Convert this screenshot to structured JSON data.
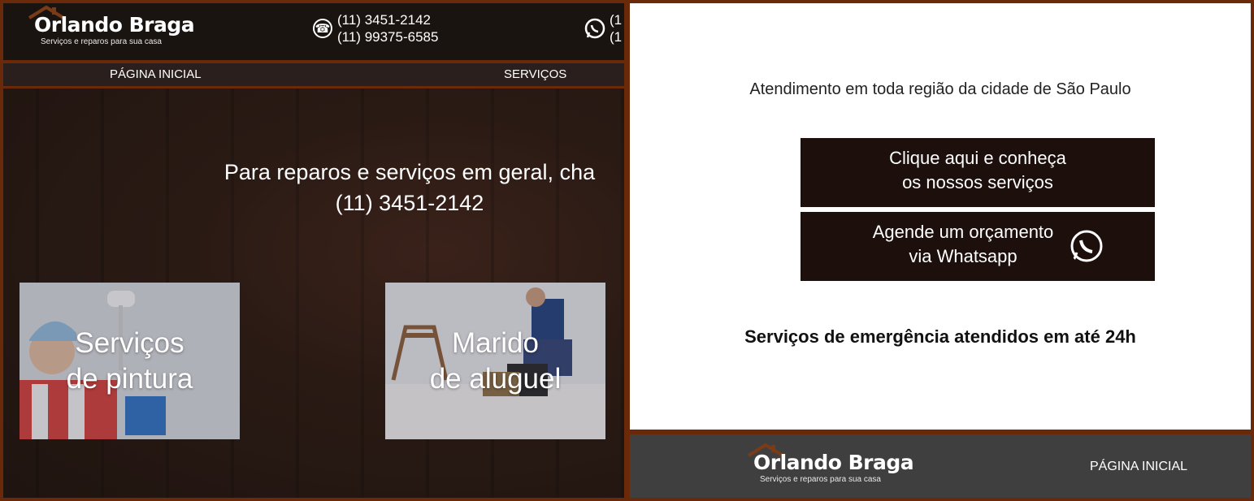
{
  "brand": {
    "name": "Orlando Braga",
    "tagline": "Serviços e reparos para sua casa"
  },
  "header": {
    "phone_landline_1": "(11) 3451-2142",
    "phone_landline_2": "(11) 99375-6585",
    "whatsapp_line_1": "(1",
    "whatsapp_line_2": "(1"
  },
  "nav": {
    "items": [
      {
        "label": "PÁGINA INICIAL"
      },
      {
        "label": "SERVIÇOS"
      }
    ]
  },
  "hero": {
    "headline_line1": "Para reparos e serviços em geral, cha",
    "headline_line2": "(11) 3451-2142"
  },
  "cards": [
    {
      "line1": "Serviços",
      "line2": "de pintura"
    },
    {
      "line1": "Marido",
      "line2": "de aluguel"
    }
  ],
  "panel": {
    "coverage": "Atendimento em toda região da cidade de São Paulo",
    "button_services_line1": "Clique aqui e conheça",
    "button_services_line2": "os nossos serviços",
    "button_whatsapp_line1": "Agende um orçamento",
    "button_whatsapp_line2": "via Whatsapp",
    "emergency": "Serviços de emergência atendidos em até 24h"
  },
  "footer": {
    "nav_home": "PÁGINA INICIAL"
  },
  "colors": {
    "brand_brown": "#6a2a0a",
    "dark_bar": "#1a1411",
    "button_dark": "#1c0f0c",
    "footer_gray": "#3f3f3f"
  },
  "icons": [
    "roof-icon",
    "phone-icon",
    "whatsapp-icon"
  ]
}
